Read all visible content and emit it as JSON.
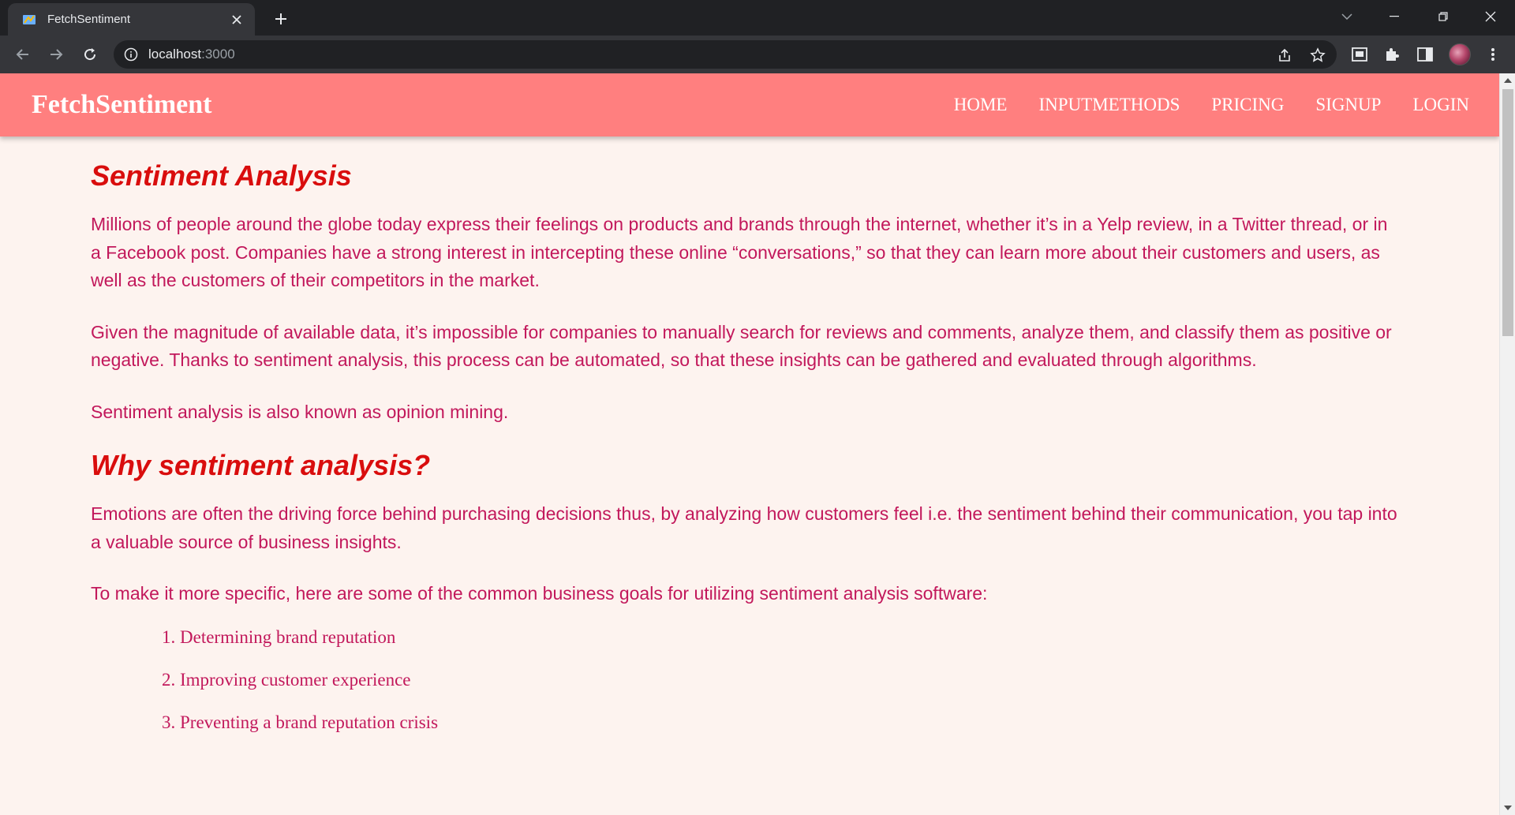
{
  "browser": {
    "tab_title": "FetchSentiment",
    "url_host": "localhost",
    "url_port": ":3000"
  },
  "site": {
    "brand": "FetchSentiment",
    "nav": [
      "HOME",
      "INPUTMETHODS",
      "PRICING",
      "SIGNUP",
      "LOGIN"
    ]
  },
  "content": {
    "heading1": "Sentiment Analysis",
    "p1": "Millions of people around the globe today express their feelings on products and brands through the internet, whether it’s in a Yelp review, in a Twitter thread, or in a Facebook post. Companies have a strong interest in intercepting these online “conversations,” so that they can learn more about their customers and users, as well as the customers of their competitors in the market.",
    "p2": "Given the magnitude of available data, it’s impossible for companies to manually search for reviews and comments, analyze them, and classify them as positive or negative. Thanks to sentiment analysis, this process can be automated, so that these insights can be gathered and evaluated through algorithms.",
    "p3": "Sentiment analysis is also known as opinion mining.",
    "heading2": "Why sentiment analysis?",
    "p4": "Emotions are often the driving force behind purchasing decisions thus, by analyzing how customers feel i.e. the sentiment behind their communication, you tap into a valuable source of business insights.",
    "p5": "To make it more specific, here are some of the common business goals for utilizing sentiment analysis software:",
    "goals": [
      "1. Determining brand reputation",
      "2. Improving customer experience",
      "3. Preventing a brand reputation crisis"
    ]
  },
  "colors": {
    "nav_bg": "#ff7f7f",
    "heading": "#d90d0d",
    "body_text": "#c2185b",
    "page_bg": "#fdf3ef"
  }
}
